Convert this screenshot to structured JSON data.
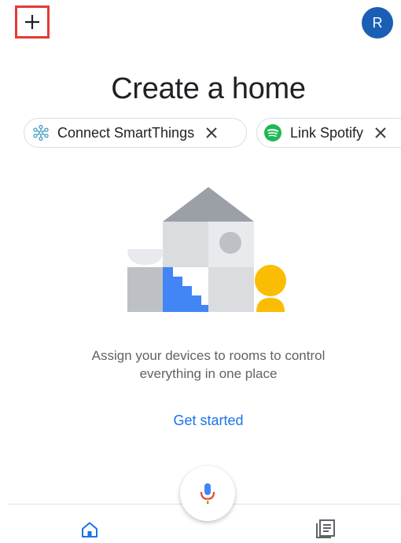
{
  "header": {
    "add_icon": "plus-icon",
    "avatar_initial": "R",
    "colors": {
      "add_highlight": "#e53935",
      "avatar": "#1a5fb4"
    }
  },
  "main": {
    "title": "Create a home",
    "chips": [
      {
        "icon": "smartthings-icon",
        "label": "Connect SmartThings",
        "close_icon": "close-icon"
      },
      {
        "icon": "spotify-icon",
        "label": "Link Spotify",
        "close_icon": "close-icon"
      }
    ],
    "illustration": "home-rooms-illustration",
    "description_line1": "Assign your devices to rooms to control",
    "description_line2": "everything in one place",
    "cta": "Get started",
    "colors": {
      "accent": "#1a73e8",
      "spotify": "#1db954",
      "illus_blue": "#4285f4",
      "illus_yellow": "#fbbc04"
    }
  },
  "bottom_nav": {
    "mic_icon": "microphone-icon",
    "items": [
      {
        "icon": "home-icon",
        "active": true
      },
      {
        "icon": "feed-icon",
        "active": false
      }
    ]
  }
}
